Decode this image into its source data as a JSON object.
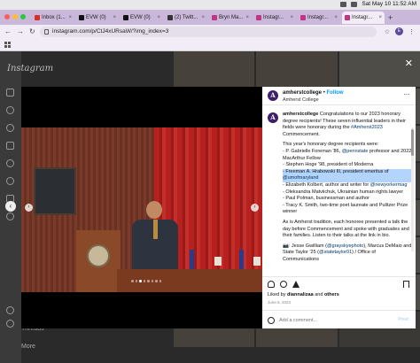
{
  "menubar": {
    "datetime": "Sat May 10  11:52 AM"
  },
  "tabs": [
    {
      "label": "Inbox (1...",
      "color": "#d93025",
      "active": false
    },
    {
      "label": "EVW (0)",
      "color": "#111111",
      "active": false
    },
    {
      "label": "EVW (0)",
      "color": "#111111",
      "active": false
    },
    {
      "label": "(2) Twitt...",
      "color": "#333333",
      "active": false
    },
    {
      "label": "Bryn Ma...",
      "color": "#c13584",
      "active": false
    },
    {
      "label": "Instagr...",
      "color": "#c13584",
      "active": false
    },
    {
      "label": "Instagr...",
      "color": "#c13584",
      "active": false
    },
    {
      "label": "Instagr...",
      "color": "#c13584",
      "active": true
    }
  ],
  "browser": {
    "url": "instagram.com/p/CtJ4xURsaW/?img_index=3",
    "profile_initial": "E"
  },
  "instagram": {
    "logo": "Instagram",
    "threads_label": "Threads",
    "more_label": "More"
  },
  "post": {
    "username": "amherstcollege",
    "separator": "•",
    "follow_label": "Follow",
    "location": "Amherst College",
    "more_label": "···",
    "caption": {
      "username": "amherstcollege",
      "intro": "Congratulations to our 2023 honorary degree recipients! These seven influential leaders in their fields were honorary during the",
      "intro_tag": "#Amherst2023",
      "intro_end": "Commencement.",
      "list_intro": "This year's honorary degree recipients were:",
      "r1a": "- P. Gabrielle Foreman '86,",
      "r1_tag": "@pennstate",
      "r1b": "professor and 2022 MacArthur Fellow",
      "r2": "- Stephen Hoge '98, president of Moderna",
      "r3_hl": "- Freeman A. Hrabowski III, president emeritus of",
      "r3_tag": "@umofmaryland",
      "r4": "- Elizabeth Kolbert, author and writer for",
      "r4_tag": "@newyorkermag",
      "r5": "- Oleksandra Matviichuk, Ukrainian human rights lawyer",
      "r6": "- Paul Polman, businessman and author",
      "r7": "- Tracy K. Smith, two-time poet laureate and Pulitzer Prize winner",
      "tradition": "As is Amherst tradition, each honoree presented a talk the day before Commencement and spoke with graduates and their families. Listen to their talks at the link in bio.",
      "credit_a": "📷: Jesse Gwilliam",
      "credit_tag1": "@grayskyephoto",
      "credit_b": ", Marcus DeMaio and State Taylor '25",
      "credit_tag2": "@statetaylor01",
      "credit_c": "/ Office of Communications"
    },
    "liked_prefix": "Liked by",
    "liked_user": "diannalizaa",
    "liked_mid": "and",
    "liked_others": "others",
    "date": "June 6, 2023",
    "comment_placeholder": "Add a comment...",
    "post_label": "Post"
  },
  "carousel": {
    "current_index": 3,
    "total": 8
  },
  "colors": {
    "follow": "#0095f6",
    "college_purple": "#3f1f69",
    "highlight": "#b3d4fc"
  }
}
